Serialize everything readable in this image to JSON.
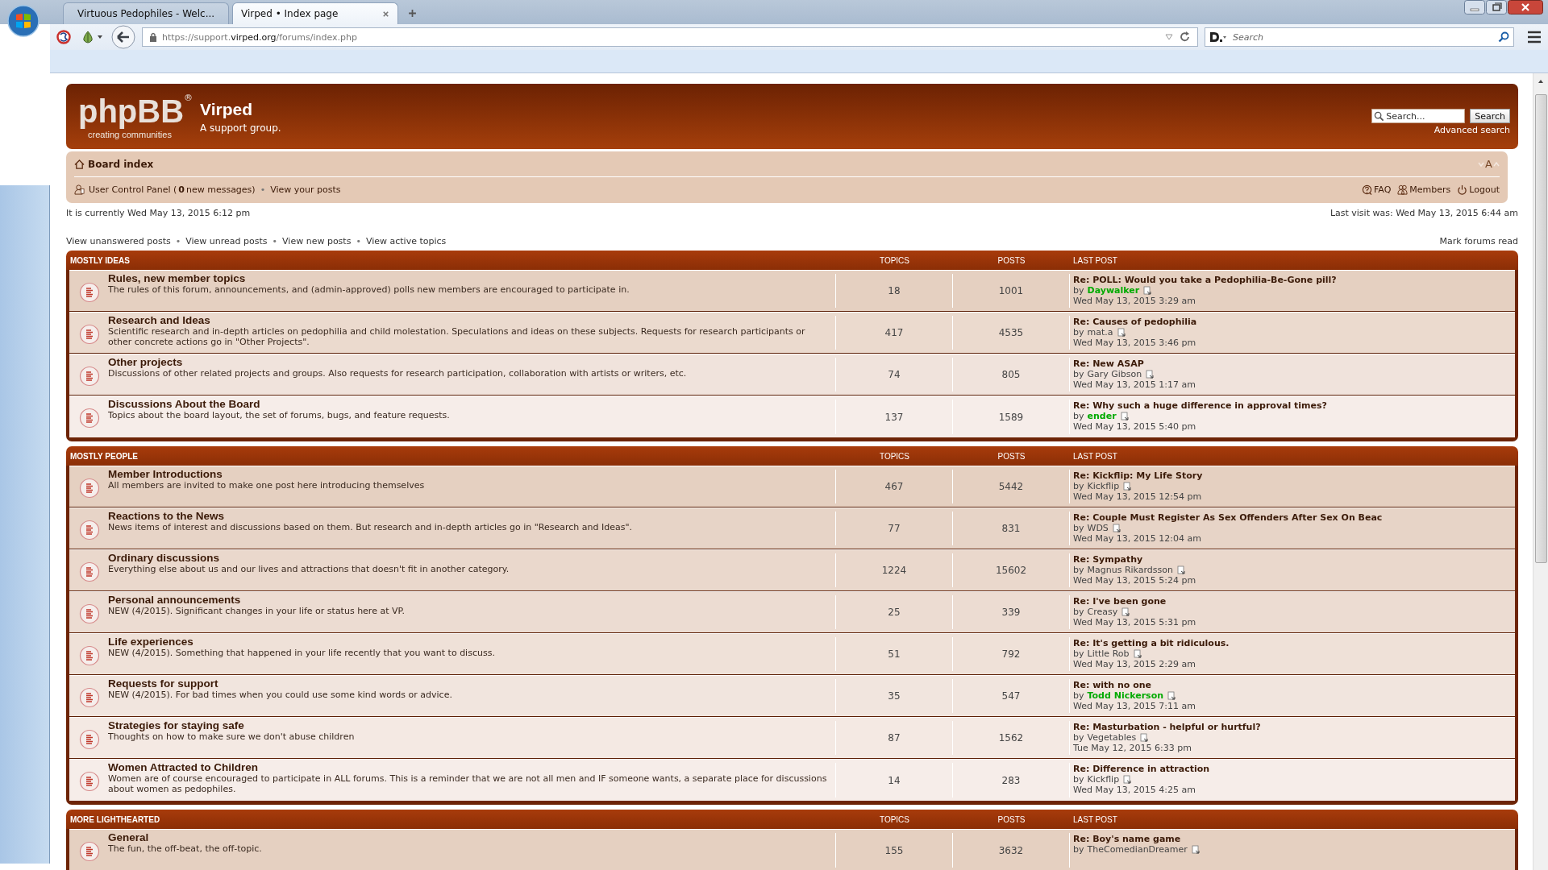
{
  "browser": {
    "tabs": [
      {
        "label": "Virtuous Pedophiles - Welc...",
        "selected": false,
        "kind": "site"
      },
      {
        "label": "Virped • Index page",
        "selected": true,
        "kind": "plain"
      }
    ],
    "url": {
      "prefix": "https://support.",
      "domain": "virped.org",
      "path": "/forums/index.php"
    },
    "search": {
      "placeholder": "Search"
    }
  },
  "header": {
    "logo": {
      "text": "phpBB",
      "mark": "®",
      "tagline": "creating communities"
    },
    "title": "Virped",
    "description": "A support group.",
    "search": {
      "placeholder": "Search...",
      "button": "Search",
      "advanced": "Advanced search"
    }
  },
  "navbar": {
    "breadcrumb": "Board index",
    "font_size": "A",
    "user_links": [
      {
        "kind": "link",
        "text": "User Control Panel (**0** new messages)"
      },
      {
        "kind": "separator",
        "text": "•"
      },
      {
        "kind": "link",
        "text": "View your posts"
      }
    ],
    "quick_links": [
      {
        "kind": "faq",
        "label": "FAQ"
      },
      {
        "kind": "members",
        "label": "Members"
      },
      {
        "kind": "logout",
        "label": "Logout"
      }
    ]
  },
  "current_time": "It is currently Wed May 13, 2015 6:12 pm",
  "last_visit": "Last visit was: Wed May 13, 2015 6:44 am",
  "view_links": [
    {
      "kind": "link",
      "text": "View unanswered posts"
    },
    {
      "kind": "separator",
      "text": "•"
    },
    {
      "kind": "link",
      "text": "View unread posts"
    },
    {
      "kind": "separator",
      "text": "•"
    },
    {
      "kind": "link",
      "text": "View new posts"
    },
    {
      "kind": "separator",
      "text": "•"
    },
    {
      "kind": "link",
      "text": "View active topics"
    }
  ],
  "mark_read": "Mark forums read",
  "categories": [
    {
      "name": "MOSTLY IDEAS",
      "columns": [
        "TOPICS",
        "POSTS",
        "LAST POST"
      ],
      "forums": [
        {
          "name": "Rules, new member topics",
          "description": "The rules of this forum, announcements, and (admin-approved) polls new members are encouraged to participate in.",
          "topics": "18",
          "posts": "1001",
          "last_post": {
            "title": "Re: POLL: Would you take a Pedophilia-Be-Gone pill?",
            "by": "by",
            "author": "Daywalker",
            "color": "#00aa00",
            "time": "Wed May 13, 2015 3:29 am"
          }
        },
        {
          "name": "Research and Ideas",
          "description": "Scientific research and in-depth articles on pedophilia and child molestation. Speculations and ideas on these subjects. Requests for research participants or other concrete actions go in \"Other Projects\".",
          "topics": "417",
          "posts": "4535",
          "last_post": {
            "title": "Re: Causes of pedophilia",
            "by": "by",
            "author": "mat.a",
            "time": "Wed May 13, 2015 3:46 pm"
          }
        },
        {
          "name": "Other projects",
          "description": "Discussions of other related projects and groups. Also requests for research participation, collaboration with artists or writers, etc.",
          "topics": "74",
          "posts": "805",
          "last_post": {
            "title": "Re: New ASAP",
            "by": "by",
            "author": "Gary Gibson",
            "time": "Wed May 13, 2015 1:17 am"
          }
        },
        {
          "name": "Discussions About the Board",
          "description": "Topics about the board layout, the set of forums, bugs, and feature requests.",
          "topics": "137",
          "posts": "1589",
          "last_post": {
            "title": "Re: Why such a huge difference in approval times?",
            "by": "by",
            "author": "ender",
            "color": "#00aa00",
            "time": "Wed May 13, 2015 5:40 pm"
          }
        }
      ]
    },
    {
      "name": "MOSTLY PEOPLE",
      "columns": [
        "TOPICS",
        "POSTS",
        "LAST POST"
      ],
      "forums": [
        {
          "name": "Member Introductions",
          "description": "All members are invited to make one post here introducing themselves",
          "topics": "467",
          "posts": "5442",
          "last_post": {
            "title": "Re: Kickflip: My Life Story",
            "by": "by",
            "author": "Kickflip",
            "time": "Wed May 13, 2015 12:54 pm"
          }
        },
        {
          "name": "Reactions to the News",
          "description": "News items of interest and discussions based on them. But research and in-depth articles go in \"Research and Ideas\".",
          "topics": "77",
          "posts": "831",
          "last_post": {
            "title": "Re: Couple Must Register As Sex Offenders After Sex On Beac",
            "by": "by",
            "author": "WDS",
            "time": "Wed May 13, 2015 12:04 am"
          }
        },
        {
          "name": "Ordinary discussions",
          "description": "Everything else about us and our lives and attractions that doesn't fit in another category.",
          "topics": "1224",
          "posts": "15602",
          "last_post": {
            "title": "Re: Sympathy",
            "by": "by",
            "author": "Magnus Rikardsson",
            "time": "Wed May 13, 2015 5:24 pm"
          }
        },
        {
          "name": "Personal announcements",
          "description": "NEW (4/2015). Significant changes in your life or status here at VP.",
          "topics": "25",
          "posts": "339",
          "last_post": {
            "title": "Re: I've been gone",
            "by": "by",
            "author": "Creasy",
            "time": "Wed May 13, 2015 5:31 pm"
          }
        },
        {
          "name": "Life experiences",
          "description": "NEW (4/2015). Something that happened in your life recently that you want to discuss.",
          "topics": "51",
          "posts": "792",
          "last_post": {
            "title": "Re: It's getting a bit ridiculous.",
            "by": "by",
            "author": "Little Rob",
            "time": "Wed May 13, 2015 2:29 am"
          }
        },
        {
          "name": "Requests for support",
          "description": "NEW (4/2015). For bad times when you could use some kind words or advice.",
          "topics": "35",
          "posts": "547",
          "last_post": {
            "title": "Re: with no one",
            "by": "by",
            "author": "Todd Nickerson",
            "color": "#00aa00",
            "time": "Wed May 13, 2015 7:11 am"
          }
        },
        {
          "name": "Strategies for staying safe",
          "description": "Thoughts on how to make sure we don't abuse children",
          "topics": "87",
          "posts": "1562",
          "last_post": {
            "title": "Re: Masturbation - helpful or hurtful?",
            "by": "by",
            "author": "Vegetables",
            "time": "Tue May 12, 2015 6:33 pm"
          }
        },
        {
          "name": "Women Attracted to Children",
          "description": "Women are of course encouraged to participate in ALL forums. This is a reminder that we are not all men and IF someone wants, a separate place for discussions about women as pedophiles.",
          "topics": "14",
          "posts": "283",
          "last_post": {
            "title": "Re: Difference in attraction",
            "by": "by",
            "author": "Kickflip",
            "time": "Wed May 13, 2015 4:25 am"
          }
        }
      ]
    },
    {
      "name": "MORE LIGHTHEARTED",
      "columns": [
        "TOPICS",
        "POSTS",
        "LAST POST"
      ],
      "forums": [
        {
          "name": "General",
          "description": "The fun, the off-beat, the off-topic.",
          "topics": "155",
          "posts": "3632",
          "last_post": {
            "title": "Re: Boy's name game",
            "by": "by",
            "author": "TheComedianDreamer"
          }
        }
      ]
    }
  ]
}
